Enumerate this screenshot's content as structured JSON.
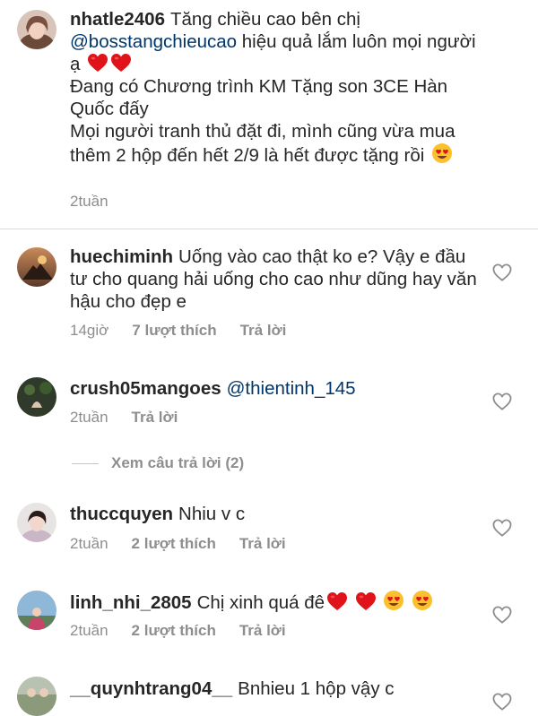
{
  "comments": [
    {
      "username": "nhatle2406",
      "text_part1": "Tăng chiều cao bên chị",
      "mention": "@bosstangchieucao",
      "text_part2": "hiệu quả lắm luôn mọi người ạ",
      "line_promo": "Đang có Chương trình KM Tặng son 3CE Hàn Quốc đấy",
      "line_more": "Mọi người tranh thủ đặt đi, mình cũng vừa mua thêm 2 hộp đến hết 2/9 là hết được tặng rồi",
      "time": "2tuần"
    },
    {
      "username": "huechiminh",
      "text": "Uống vào cao thật ko e? Vậy e đầu tư cho quang hải uống cho cao như dũng hay văn hậu cho đẹp e",
      "time": "14giờ",
      "likes": "7 lượt thích",
      "reply": "Trả lời"
    },
    {
      "username": "crush05mangoes",
      "mention": "@thientinh_145",
      "time": "2tuần",
      "reply": "Trả lời"
    },
    {
      "username": "thuccquyen",
      "text": "Nhiu v c",
      "time": "2tuần",
      "likes": "2 lượt thích",
      "reply": "Trả lời"
    },
    {
      "username": "linh_nhi_2805",
      "text": "Chị xinh quá đê",
      "time": "2tuần",
      "likes": "2 lượt thích",
      "reply": "Trả lời"
    },
    {
      "username": "__quynhtrang04__",
      "text": "Bnhieu 1 hộp vậy c"
    }
  ],
  "view_replies": "Xem câu trả lời (2)",
  "icons": {
    "like": "heart-outline-icon",
    "red_heart": "red-heart-emoji",
    "heart_eyes": "heart-eyes-emoji"
  },
  "colors": {
    "text": "#262626",
    "meta": "#8e8e8e",
    "mention": "#003569",
    "heart_red": "#e0131b"
  }
}
